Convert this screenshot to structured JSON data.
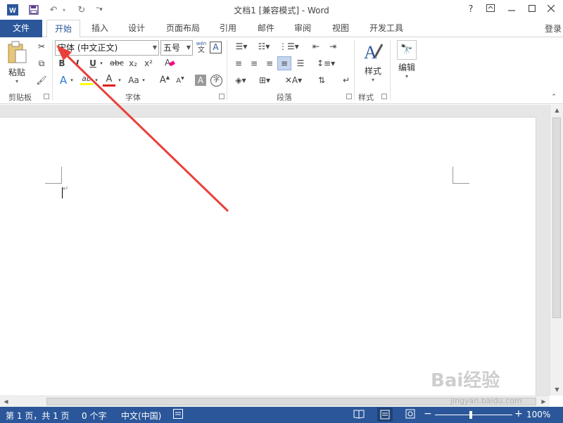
{
  "window": {
    "title": "文档1 [兼容模式] - Word",
    "help": "?",
    "minimize": "—",
    "maximize": "☐",
    "close": "✕"
  },
  "quick_access": {
    "app_icon": "W",
    "save": "💾",
    "undo": "↶",
    "redo": "↻",
    "customize": "⇣"
  },
  "tabs": {
    "file": "文件",
    "items": [
      "开始",
      "插入",
      "设计",
      "页面布局",
      "引用",
      "邮件",
      "审阅",
      "视图",
      "开发工具"
    ],
    "active": "开始",
    "login": "登录"
  },
  "ribbon": {
    "clipboard": {
      "label": "剪贴板",
      "paste": "粘贴"
    },
    "font": {
      "label": "字体",
      "font_name": "宋体 (中文正文)",
      "font_size": "五号",
      "wen_label": "wén",
      "wen_char": "文",
      "a_box": "A",
      "bold": "B",
      "italic": "I",
      "underline": "U",
      "strike": "abc",
      "subscript": "x₂",
      "superscript": "x²",
      "clear": "A",
      "grow": "A",
      "shrink": "A",
      "case": "Aa",
      "highlight": "ab",
      "color": "A",
      "shade": "A",
      "circle": "字"
    },
    "paragraph": {
      "label": "段落"
    },
    "styles": {
      "label": "样式",
      "button": "样式"
    },
    "editing": {
      "button": "编辑"
    }
  },
  "status": {
    "page": "第 1 页，共 1 页",
    "words": "0 个字",
    "lang": "中文(中国)",
    "zoom": "100%"
  },
  "watermark": {
    "text": "Bai经验",
    "url": "jingyan.baidu.com"
  },
  "colors": {
    "accent": "#2b579a",
    "arrow": "#e8413b",
    "highlight_yellow": "#ffff00",
    "font_red": "#e02020"
  }
}
